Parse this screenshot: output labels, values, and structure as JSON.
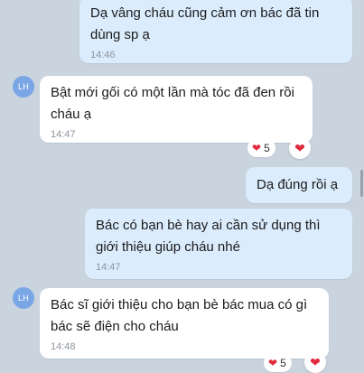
{
  "messages": [
    {
      "text": "Dạ vâng cháu cũng cảm ơn bác đã tin dùng sp ạ",
      "time": "14:46"
    },
    {
      "text": "Bật mới gối có một lần mà tóc đã đen rồi cháu ạ",
      "time": "14:47",
      "avatar": "LH",
      "reaction_count": "5"
    },
    {
      "text": "Dạ đúng rồi ạ"
    },
    {
      "text": "Bác có bạn bè hay ai cần sử dụng thì giới thiệu giúp cháu nhé",
      "time": "14:47"
    },
    {
      "text": "Bác sĩ giới thiệu cho bạn bè bác mua có gì bác sẽ điện cho cháu",
      "time": "14:48",
      "avatar": "LH",
      "reaction_count": "5"
    }
  ],
  "colors": {
    "outgoing_bubble": "#dbecfd",
    "incoming_bubble": "#ffffff",
    "avatar": "#7aa6e6",
    "heart": "#e02a3c"
  }
}
